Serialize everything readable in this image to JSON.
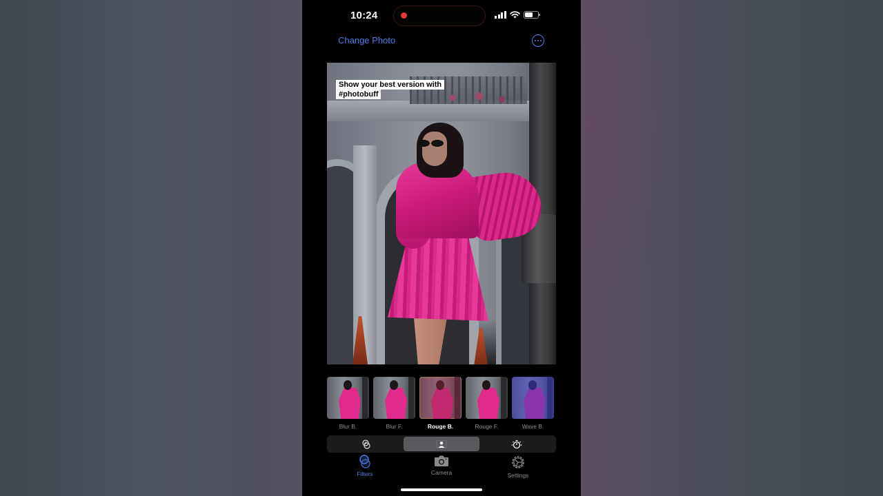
{
  "status_bar": {
    "time": "10:24",
    "recording": true,
    "battery_level_percent": 60,
    "icons": [
      "signal-icon",
      "wifi-icon",
      "battery-icon"
    ]
  },
  "nav": {
    "change_photo_label": "Change Photo",
    "more_icon": "ellipsis-circle-icon"
  },
  "photo": {
    "caption_line1": "Show your best version with",
    "caption_line2": "#photobuff"
  },
  "filters": [
    {
      "label": "Blur B.",
      "selected": false,
      "tint": "rgba(0,0,0,0)"
    },
    {
      "label": "Blur F.",
      "selected": false,
      "tint": "rgba(0,0,0,0)"
    },
    {
      "label": "Rouge B.",
      "selected": true,
      "tint": "rgba(150,40,70,0.45)"
    },
    {
      "label": "Rouge F.",
      "selected": false,
      "tint": "rgba(0,0,0,0)"
    },
    {
      "label": "Wave B.",
      "selected": false,
      "tint": "rgba(60,60,200,0.55)"
    }
  ],
  "segmented": {
    "items": [
      {
        "icon": "filters-overlap-icon",
        "selected": false
      },
      {
        "icon": "portrait-icon",
        "selected": true
      },
      {
        "icon": "timer-sun-icon",
        "selected": false
      }
    ]
  },
  "tabbar": {
    "items": [
      {
        "label": "Filters",
        "icon": "filters-icon",
        "active": true
      },
      {
        "label": "Camera",
        "icon": "camera-icon",
        "active": false
      },
      {
        "label": "Settings",
        "icon": "gear-icon",
        "active": false
      }
    ]
  },
  "colors": {
    "accent": "#4c7ee8",
    "selected_filter_border": "#9cc46a",
    "recording_dot": "#e03a3a"
  }
}
